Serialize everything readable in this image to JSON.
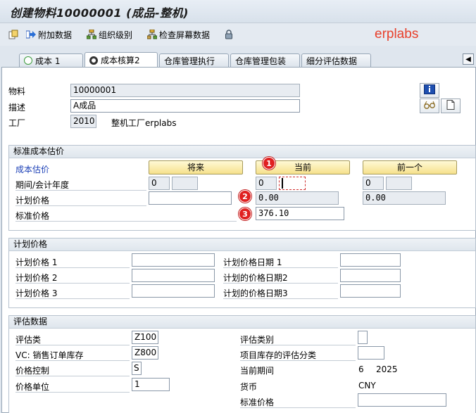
{
  "window": {
    "title": "创建物料10000001 (成品-整机)"
  },
  "toolbar": {
    "items": [
      {
        "label": ""
      },
      {
        "label": "附加数据"
      },
      {
        "label": "组织级别"
      },
      {
        "label": "检查屏幕数据"
      }
    ]
  },
  "brand": "erplabs",
  "tabs": [
    {
      "label": "成本 1"
    },
    {
      "label": "成本核算2",
      "active": true
    },
    {
      "label": "仓库管理执行"
    },
    {
      "label": "仓库管理包装"
    },
    {
      "label": "细分评估数据"
    }
  ],
  "header": {
    "material_label": "物料",
    "material_value": "10000001",
    "desc_label": "描述",
    "desc_value": "A成品",
    "plant_label": "工厂",
    "plant_value": "2010",
    "plant_name": "整机工厂erplabs"
  },
  "std_cost": {
    "section_title": "标准成本估价",
    "cost_est_label": "成本估价",
    "btn_future": "将来",
    "btn_current": "当前",
    "btn_previous": "前一个",
    "period_label": "期间/会计年度",
    "planned_price_label": "计划价格",
    "std_price_label": "标准价格",
    "future": {
      "period": "0",
      "year": "",
      "planned_price": ""
    },
    "current": {
      "period": "0",
      "year": "",
      "planned_price": "0.00",
      "std_price": "376.10"
    },
    "previous": {
      "period": "0",
      "year": "",
      "planned_price": "0.00"
    },
    "badges": [
      "1",
      "2",
      "3"
    ]
  },
  "planned": {
    "section_title": "计划价格",
    "price1_label": "计划价格 1",
    "price2_label": "计划价格 2",
    "price3_label": "计划价格 3",
    "date1_label": "计划价格日期 1",
    "date2_label": "计划的价格日期2",
    "date3_label": "计划的价格日期3",
    "price1": "",
    "price2": "",
    "price3": "",
    "date1": "",
    "date2": "",
    "date3": ""
  },
  "valuation": {
    "section_title": "评估数据",
    "val_class_label": "评估类",
    "val_class_value": "Z100",
    "vc_label": "VC: 销售订单库存",
    "vc_value": "Z800",
    "price_ctrl_label": "价格控制",
    "price_ctrl_value": "S",
    "price_unit_label": "价格单位",
    "price_unit_value": "1",
    "val_category_label": "评估类别",
    "val_category_value": "",
    "proj_stock_label": "项目库存的评估分类",
    "proj_stock_value": "",
    "cur_period_label": "当前期间",
    "cur_period_value": "6",
    "cur_year_value": "2025",
    "currency_label": "货币",
    "currency_value": "CNY",
    "std_price_label": "标准价格",
    "std_price_value": ""
  },
  "colors": {
    "accent_blue": "#1b3fb6",
    "badge_red": "#e02020",
    "button_yellow": "#f6e18c",
    "brand": "#e8402b"
  }
}
